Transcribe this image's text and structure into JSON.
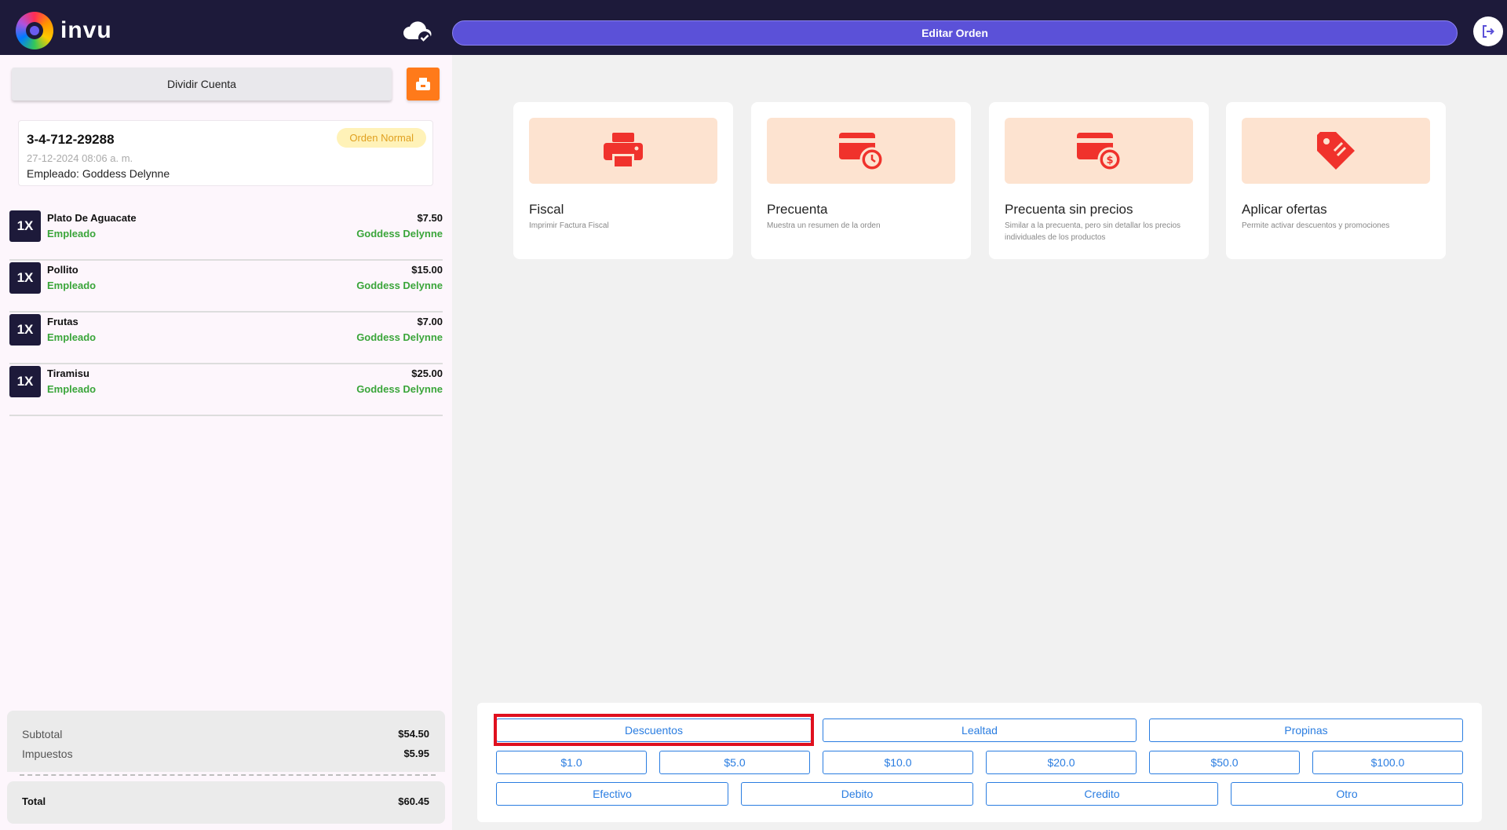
{
  "header": {
    "brand": "invu",
    "edit_order_label": "Editar Orden"
  },
  "left_panel": {
    "split_label": "Dividir Cuenta",
    "order": {
      "number": "3-4-712-29288",
      "type": "Orden Normal",
      "date": "27-12-2024 08:06 a. m.",
      "employee_label": "Empleado:",
      "employee_name": "Goddess Delynne"
    },
    "items": [
      {
        "qty": "1X",
        "name": "Plato De Aguacate",
        "role": "Empleado",
        "price": "$7.50",
        "employee": "Goddess Delynne"
      },
      {
        "qty": "1X",
        "name": "Pollito",
        "role": "Empleado",
        "price": "$15.00",
        "employee": "Goddess Delynne"
      },
      {
        "qty": "1X",
        "name": "Frutas",
        "role": "Empleado",
        "price": "$7.00",
        "employee": "Goddess Delynne"
      },
      {
        "qty": "1X",
        "name": "Tiramisu",
        "role": "Empleado",
        "price": "$25.00",
        "employee": "Goddess Delynne"
      }
    ],
    "totals": {
      "subtotal_label": "Subtotal",
      "subtotal_value": "$54.50",
      "tax_label": "Impuestos",
      "tax_value": "$5.95",
      "total_label": "Total",
      "total_value": "$60.45"
    }
  },
  "cards": [
    {
      "title": "Fiscal",
      "desc": "Imprimir Factura Fiscal",
      "icon": "printer-icon"
    },
    {
      "title": "Precuenta",
      "desc": "Muestra un resumen de la orden",
      "icon": "card-clock-icon"
    },
    {
      "title": "Precuenta sin precios",
      "desc": "Similar a la precuenta, pero sin detallar los precios individuales de los productos",
      "icon": "card-dollar-icon"
    },
    {
      "title": "Aplicar ofertas",
      "desc": "Permite activar descuentos y promociones",
      "icon": "tag-icon"
    }
  ],
  "payment": {
    "row1": [
      "Descuentos",
      "Lealtad",
      "Propinas"
    ],
    "row2": [
      "$1.0",
      "$5.0",
      "$10.0",
      "$20.0",
      "$50.0",
      "$100.0"
    ],
    "row3": [
      "Efectivo",
      "Debito",
      "Credito",
      "Otro"
    ]
  },
  "colors": {
    "header_bg": "#1d1a3a",
    "accent": "#5b51d8",
    "button_blue": "#2a7de1",
    "icon_red": "#f0322c",
    "employee_green": "#3aa53a"
  }
}
